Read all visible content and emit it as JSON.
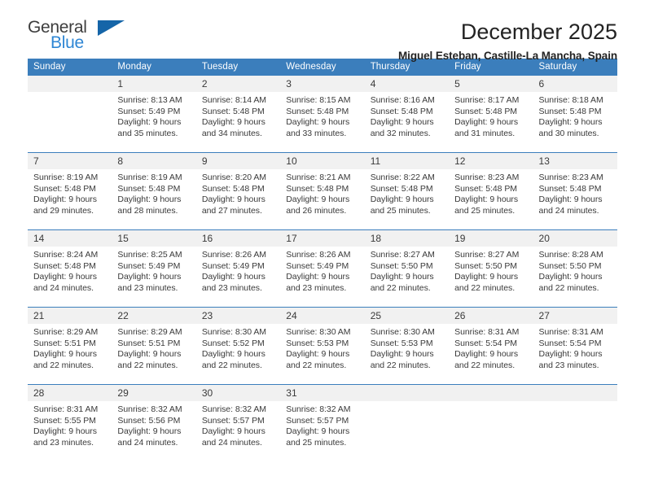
{
  "brand": {
    "name_top": "General",
    "name_bottom": "Blue",
    "triangle_color": "#1565a8",
    "blue_color": "#2e86d4"
  },
  "header": {
    "title": "December 2025",
    "subtitle": "Miguel Esteban, Castille-La Mancha, Spain"
  },
  "theme": {
    "header_blue": "#3b7ebc",
    "daynum_bg": "#f1f1f1",
    "text": "#3a3a3a"
  },
  "weekdays": [
    "Sunday",
    "Monday",
    "Tuesday",
    "Wednesday",
    "Thursday",
    "Friday",
    "Saturday"
  ],
  "weeks": [
    {
      "days": [
        {
          "num": "",
          "sunrise": "",
          "sunset": "",
          "daylight1": "",
          "daylight2": ""
        },
        {
          "num": "1",
          "sunrise": "Sunrise: 8:13 AM",
          "sunset": "Sunset: 5:49 PM",
          "daylight1": "Daylight: 9 hours",
          "daylight2": "and 35 minutes."
        },
        {
          "num": "2",
          "sunrise": "Sunrise: 8:14 AM",
          "sunset": "Sunset: 5:48 PM",
          "daylight1": "Daylight: 9 hours",
          "daylight2": "and 34 minutes."
        },
        {
          "num": "3",
          "sunrise": "Sunrise: 8:15 AM",
          "sunset": "Sunset: 5:48 PM",
          "daylight1": "Daylight: 9 hours",
          "daylight2": "and 33 minutes."
        },
        {
          "num": "4",
          "sunrise": "Sunrise: 8:16 AM",
          "sunset": "Sunset: 5:48 PM",
          "daylight1": "Daylight: 9 hours",
          "daylight2": "and 32 minutes."
        },
        {
          "num": "5",
          "sunrise": "Sunrise: 8:17 AM",
          "sunset": "Sunset: 5:48 PM",
          "daylight1": "Daylight: 9 hours",
          "daylight2": "and 31 minutes."
        },
        {
          "num": "6",
          "sunrise": "Sunrise: 8:18 AM",
          "sunset": "Sunset: 5:48 PM",
          "daylight1": "Daylight: 9 hours",
          "daylight2": "and 30 minutes."
        }
      ]
    },
    {
      "days": [
        {
          "num": "7",
          "sunrise": "Sunrise: 8:19 AM",
          "sunset": "Sunset: 5:48 PM",
          "daylight1": "Daylight: 9 hours",
          "daylight2": "and 29 minutes."
        },
        {
          "num": "8",
          "sunrise": "Sunrise: 8:19 AM",
          "sunset": "Sunset: 5:48 PM",
          "daylight1": "Daylight: 9 hours",
          "daylight2": "and 28 minutes."
        },
        {
          "num": "9",
          "sunrise": "Sunrise: 8:20 AM",
          "sunset": "Sunset: 5:48 PM",
          "daylight1": "Daylight: 9 hours",
          "daylight2": "and 27 minutes."
        },
        {
          "num": "10",
          "sunrise": "Sunrise: 8:21 AM",
          "sunset": "Sunset: 5:48 PM",
          "daylight1": "Daylight: 9 hours",
          "daylight2": "and 26 minutes."
        },
        {
          "num": "11",
          "sunrise": "Sunrise: 8:22 AM",
          "sunset": "Sunset: 5:48 PM",
          "daylight1": "Daylight: 9 hours",
          "daylight2": "and 25 minutes."
        },
        {
          "num": "12",
          "sunrise": "Sunrise: 8:23 AM",
          "sunset": "Sunset: 5:48 PM",
          "daylight1": "Daylight: 9 hours",
          "daylight2": "and 25 minutes."
        },
        {
          "num": "13",
          "sunrise": "Sunrise: 8:23 AM",
          "sunset": "Sunset: 5:48 PM",
          "daylight1": "Daylight: 9 hours",
          "daylight2": "and 24 minutes."
        }
      ]
    },
    {
      "days": [
        {
          "num": "14",
          "sunrise": "Sunrise: 8:24 AM",
          "sunset": "Sunset: 5:48 PM",
          "daylight1": "Daylight: 9 hours",
          "daylight2": "and 24 minutes."
        },
        {
          "num": "15",
          "sunrise": "Sunrise: 8:25 AM",
          "sunset": "Sunset: 5:49 PM",
          "daylight1": "Daylight: 9 hours",
          "daylight2": "and 23 minutes."
        },
        {
          "num": "16",
          "sunrise": "Sunrise: 8:26 AM",
          "sunset": "Sunset: 5:49 PM",
          "daylight1": "Daylight: 9 hours",
          "daylight2": "and 23 minutes."
        },
        {
          "num": "17",
          "sunrise": "Sunrise: 8:26 AM",
          "sunset": "Sunset: 5:49 PM",
          "daylight1": "Daylight: 9 hours",
          "daylight2": "and 23 minutes."
        },
        {
          "num": "18",
          "sunrise": "Sunrise: 8:27 AM",
          "sunset": "Sunset: 5:50 PM",
          "daylight1": "Daylight: 9 hours",
          "daylight2": "and 22 minutes."
        },
        {
          "num": "19",
          "sunrise": "Sunrise: 8:27 AM",
          "sunset": "Sunset: 5:50 PM",
          "daylight1": "Daylight: 9 hours",
          "daylight2": "and 22 minutes."
        },
        {
          "num": "20",
          "sunrise": "Sunrise: 8:28 AM",
          "sunset": "Sunset: 5:50 PM",
          "daylight1": "Daylight: 9 hours",
          "daylight2": "and 22 minutes."
        }
      ]
    },
    {
      "days": [
        {
          "num": "21",
          "sunrise": "Sunrise: 8:29 AM",
          "sunset": "Sunset: 5:51 PM",
          "daylight1": "Daylight: 9 hours",
          "daylight2": "and 22 minutes."
        },
        {
          "num": "22",
          "sunrise": "Sunrise: 8:29 AM",
          "sunset": "Sunset: 5:51 PM",
          "daylight1": "Daylight: 9 hours",
          "daylight2": "and 22 minutes."
        },
        {
          "num": "23",
          "sunrise": "Sunrise: 8:30 AM",
          "sunset": "Sunset: 5:52 PM",
          "daylight1": "Daylight: 9 hours",
          "daylight2": "and 22 minutes."
        },
        {
          "num": "24",
          "sunrise": "Sunrise: 8:30 AM",
          "sunset": "Sunset: 5:53 PM",
          "daylight1": "Daylight: 9 hours",
          "daylight2": "and 22 minutes."
        },
        {
          "num": "25",
          "sunrise": "Sunrise: 8:30 AM",
          "sunset": "Sunset: 5:53 PM",
          "daylight1": "Daylight: 9 hours",
          "daylight2": "and 22 minutes."
        },
        {
          "num": "26",
          "sunrise": "Sunrise: 8:31 AM",
          "sunset": "Sunset: 5:54 PM",
          "daylight1": "Daylight: 9 hours",
          "daylight2": "and 22 minutes."
        },
        {
          "num": "27",
          "sunrise": "Sunrise: 8:31 AM",
          "sunset": "Sunset: 5:54 PM",
          "daylight1": "Daylight: 9 hours",
          "daylight2": "and 23 minutes."
        }
      ]
    },
    {
      "days": [
        {
          "num": "28",
          "sunrise": "Sunrise: 8:31 AM",
          "sunset": "Sunset: 5:55 PM",
          "daylight1": "Daylight: 9 hours",
          "daylight2": "and 23 minutes."
        },
        {
          "num": "29",
          "sunrise": "Sunrise: 8:32 AM",
          "sunset": "Sunset: 5:56 PM",
          "daylight1": "Daylight: 9 hours",
          "daylight2": "and 24 minutes."
        },
        {
          "num": "30",
          "sunrise": "Sunrise: 8:32 AM",
          "sunset": "Sunset: 5:57 PM",
          "daylight1": "Daylight: 9 hours",
          "daylight2": "and 24 minutes."
        },
        {
          "num": "31",
          "sunrise": "Sunrise: 8:32 AM",
          "sunset": "Sunset: 5:57 PM",
          "daylight1": "Daylight: 9 hours",
          "daylight2": "and 25 minutes."
        },
        {
          "num": "",
          "sunrise": "",
          "sunset": "",
          "daylight1": "",
          "daylight2": ""
        },
        {
          "num": "",
          "sunrise": "",
          "sunset": "",
          "daylight1": "",
          "daylight2": ""
        },
        {
          "num": "",
          "sunrise": "",
          "sunset": "",
          "daylight1": "",
          "daylight2": ""
        }
      ]
    }
  ]
}
